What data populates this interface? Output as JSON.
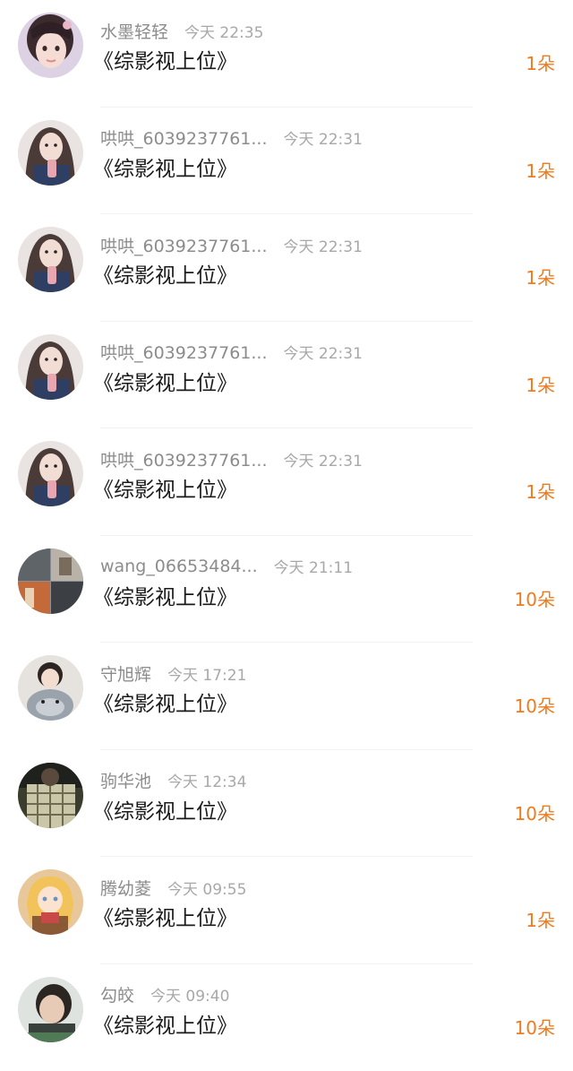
{
  "items": [
    {
      "username": "水墨轻轻",
      "time": "今天 22:35",
      "title": "《综影视上位》",
      "amount": "1朵",
      "avatar_icon": "girl-portrait-avatar"
    },
    {
      "username": "哄哄_6039237761...",
      "time": "今天 22:31",
      "title": "《综影视上位》",
      "amount": "1朵",
      "avatar_icon": "girl-with-drink-avatar"
    },
    {
      "username": "哄哄_6039237761...",
      "time": "今天 22:31",
      "title": "《综影视上位》",
      "amount": "1朵",
      "avatar_icon": "girl-with-drink-avatar"
    },
    {
      "username": "哄哄_6039237761...",
      "time": "今天 22:31",
      "title": "《综影视上位》",
      "amount": "1朵",
      "avatar_icon": "girl-with-drink-avatar"
    },
    {
      "username": "哄哄_6039237761...",
      "time": "今天 22:31",
      "title": "《综影视上位》",
      "amount": "1朵",
      "avatar_icon": "girl-with-drink-avatar"
    },
    {
      "username": "wang_06653484...",
      "time": "今天 21:11",
      "title": "《综影视上位》",
      "amount": "10朵",
      "avatar_icon": "street-collage-avatar"
    },
    {
      "username": "守旭辉",
      "time": "今天 17:21",
      "title": "《综影视上位》",
      "amount": "10朵",
      "avatar_icon": "child-with-toy-avatar"
    },
    {
      "username": "驹华池",
      "time": "今天 12:34",
      "title": "《综影视上位》",
      "amount": "10朵",
      "avatar_icon": "plaid-shirt-avatar"
    },
    {
      "username": "腾幼菱",
      "time": "今天 09:55",
      "title": "《综影视上位》",
      "amount": "1朵",
      "avatar_icon": "anime-girl-avatar"
    },
    {
      "username": "勾皎",
      "time": "今天 09:40",
      "title": "《综影视上位》",
      "amount": "10朵",
      "avatar_icon": "man-portrait-avatar"
    }
  ],
  "colors": {
    "amount": "#f07a1e",
    "username": "#8c8c8c",
    "time": "#a8a8a8",
    "title": "#1a1a1a",
    "divider": "#f2f2f2"
  }
}
